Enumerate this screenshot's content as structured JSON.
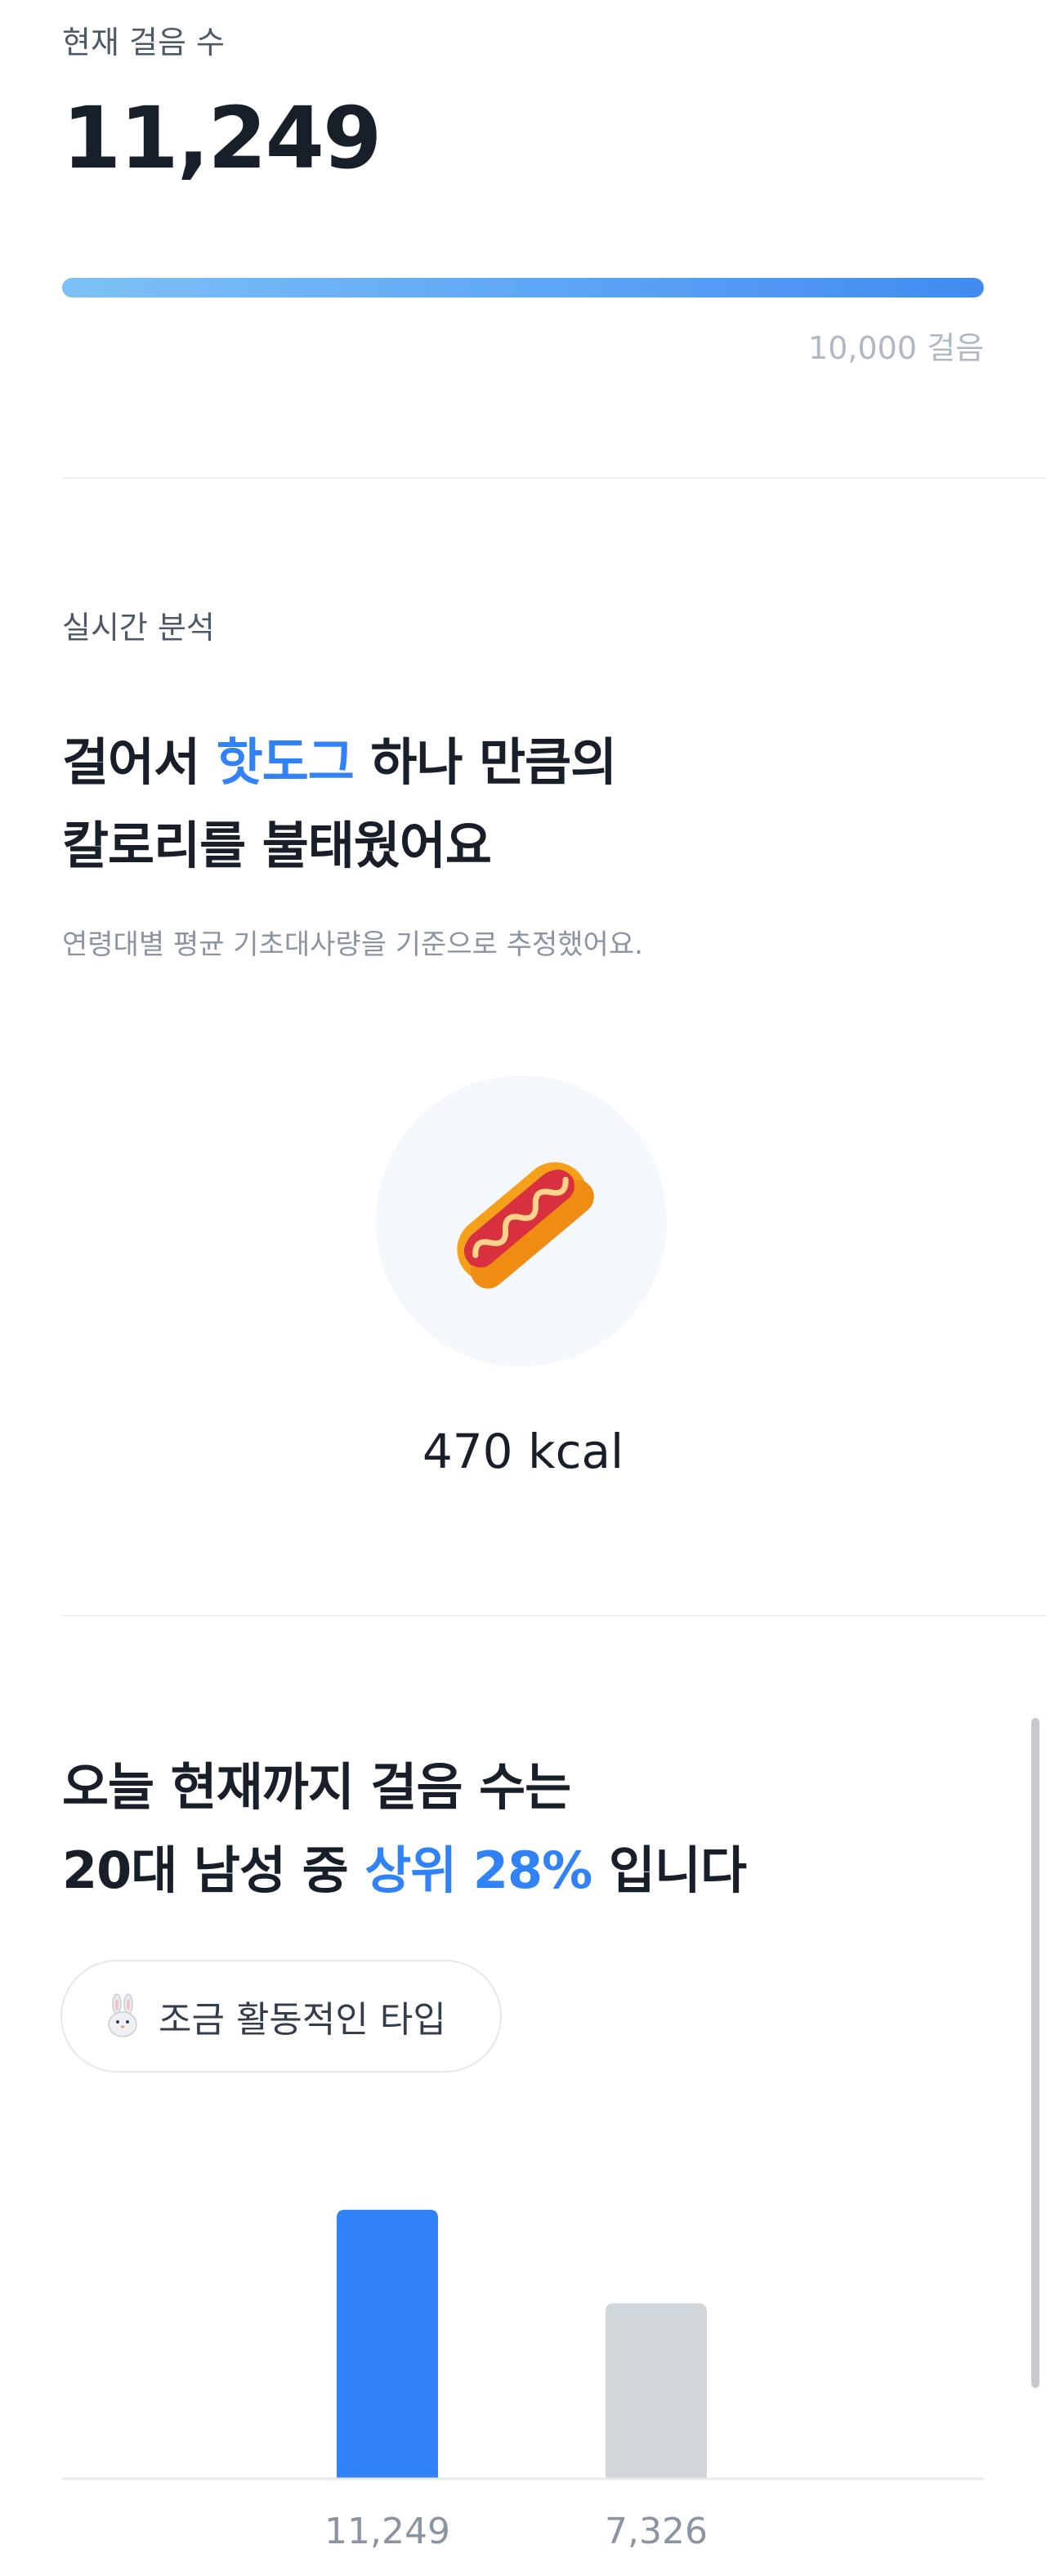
{
  "steps": {
    "label": "현재 걸음 수",
    "count": "11,249",
    "goal": "10,000 걸음",
    "progress": 1.0
  },
  "analysis": {
    "label": "실시간 분석",
    "title_prefix": "걸어서 ",
    "title_food": "핫도그",
    "title_suffix": " 하나 만큼의",
    "title_line2": "칼로리를 불태웠어요",
    "subtitle": "연령대별 평균 기초대사량을 기준으로 추정했어요.",
    "food_icon": "hotdog-icon",
    "kcal": "470 kcal"
  },
  "ranking": {
    "line1": "오늘 현재까지 걸음 수는",
    "line2_prefix": "20대 남성 중 ",
    "line2_accent": "상위 28%",
    "line2_suffix": " 입니다",
    "chip_icon": "rabbit-icon",
    "chip_label": "조금 활동적인 타입"
  },
  "colors": {
    "accent": "#3182f6",
    "bar_mine": "#3182f6",
    "bar_avg": "#d1d6db"
  },
  "chart_data": {
    "type": "bar",
    "categories": [
      "11,249",
      "7,326"
    ],
    "values": [
      11249,
      7326
    ],
    "ylim": [
      0,
      12000
    ]
  }
}
